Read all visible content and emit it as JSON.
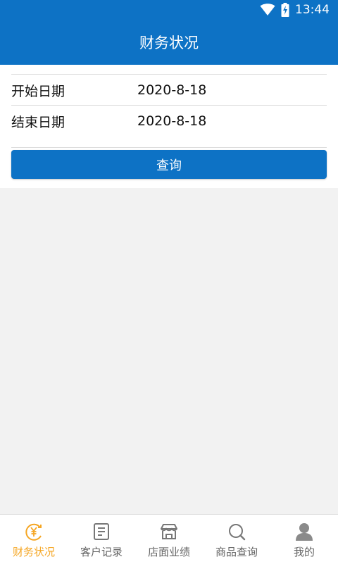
{
  "status_bar": {
    "time": "13:44",
    "icons": [
      "wifi-icon",
      "battery-charging-icon"
    ]
  },
  "header": {
    "title": "财务状况"
  },
  "form": {
    "start_label": "开始日期",
    "start_value": "2020-8-18",
    "end_label": "结束日期",
    "end_value": "2020-8-18",
    "query_button": "查询"
  },
  "tabs": [
    {
      "label": "财务状况",
      "icon": "yuan-refresh-icon",
      "active": true
    },
    {
      "label": "客户记录",
      "icon": "document-list-icon",
      "active": false
    },
    {
      "label": "店面业绩",
      "icon": "storefront-icon",
      "active": false
    },
    {
      "label": "商品查询",
      "icon": "search-icon",
      "active": false
    },
    {
      "label": "我的",
      "icon": "user-icon",
      "active": false
    }
  ],
  "colors": {
    "primary": "#0d72c5",
    "active_tab": "#f5a623",
    "inactive_tab": "#666666",
    "background": "#f2f2f2"
  }
}
